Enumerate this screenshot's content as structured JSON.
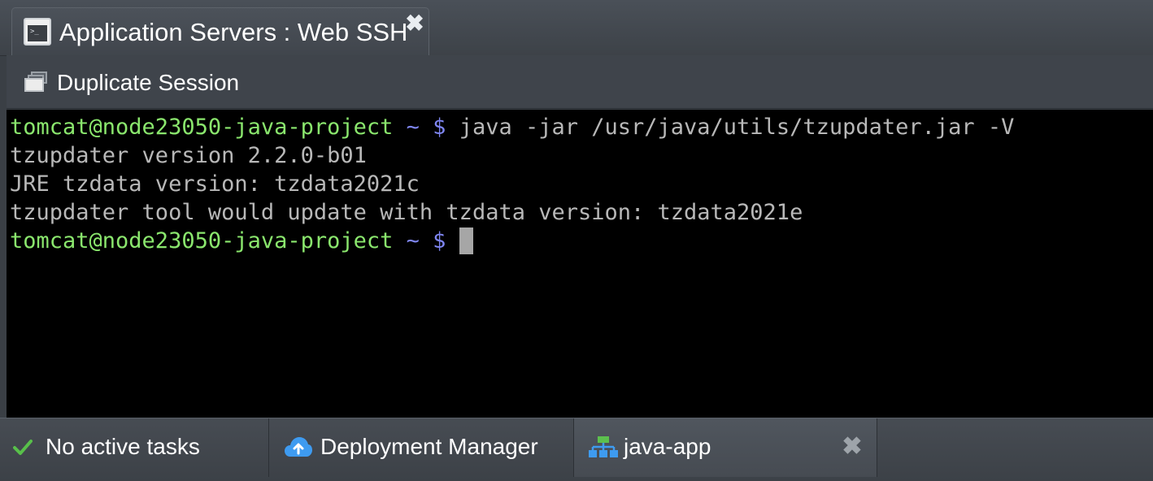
{
  "tab": {
    "title": "Application Servers : Web SSH",
    "icon": "terminal-icon",
    "close_glyph": "✖",
    "icon_prompt": ">_"
  },
  "toolbar": {
    "duplicate_label": "Duplicate Session",
    "duplicate_icon": "duplicate-windows-icon"
  },
  "terminal": {
    "lines": [
      {
        "prompt_user": "tomcat@node23050-java-project",
        "prompt_path": " ~ $",
        "command": " java -jar /usr/java/utils/tzupdater.jar -V"
      },
      {
        "output": "tzupdater version 2.2.0-b01"
      },
      {
        "output": "JRE tzdata version: tzdata2021c"
      },
      {
        "output": "tzupdater tool would update with tzdata version: tzdata2021e"
      },
      {
        "prompt_user": "tomcat@node23050-java-project",
        "prompt_path": " ~ $",
        "command": " "
      }
    ],
    "colors": {
      "prompt_user": "#8ae66d",
      "prompt_path": "#7f86f2",
      "text": "#b8b8b8",
      "background": "#000000"
    }
  },
  "bottombar": {
    "tasks_label": "No active tasks",
    "tasks_icon": "check-icon",
    "deployment_label": "Deployment Manager",
    "deployment_icon": "cloud-upload-icon",
    "app_label": "java-app",
    "app_icon": "environment-topology-icon",
    "close_glyph": "✖"
  }
}
